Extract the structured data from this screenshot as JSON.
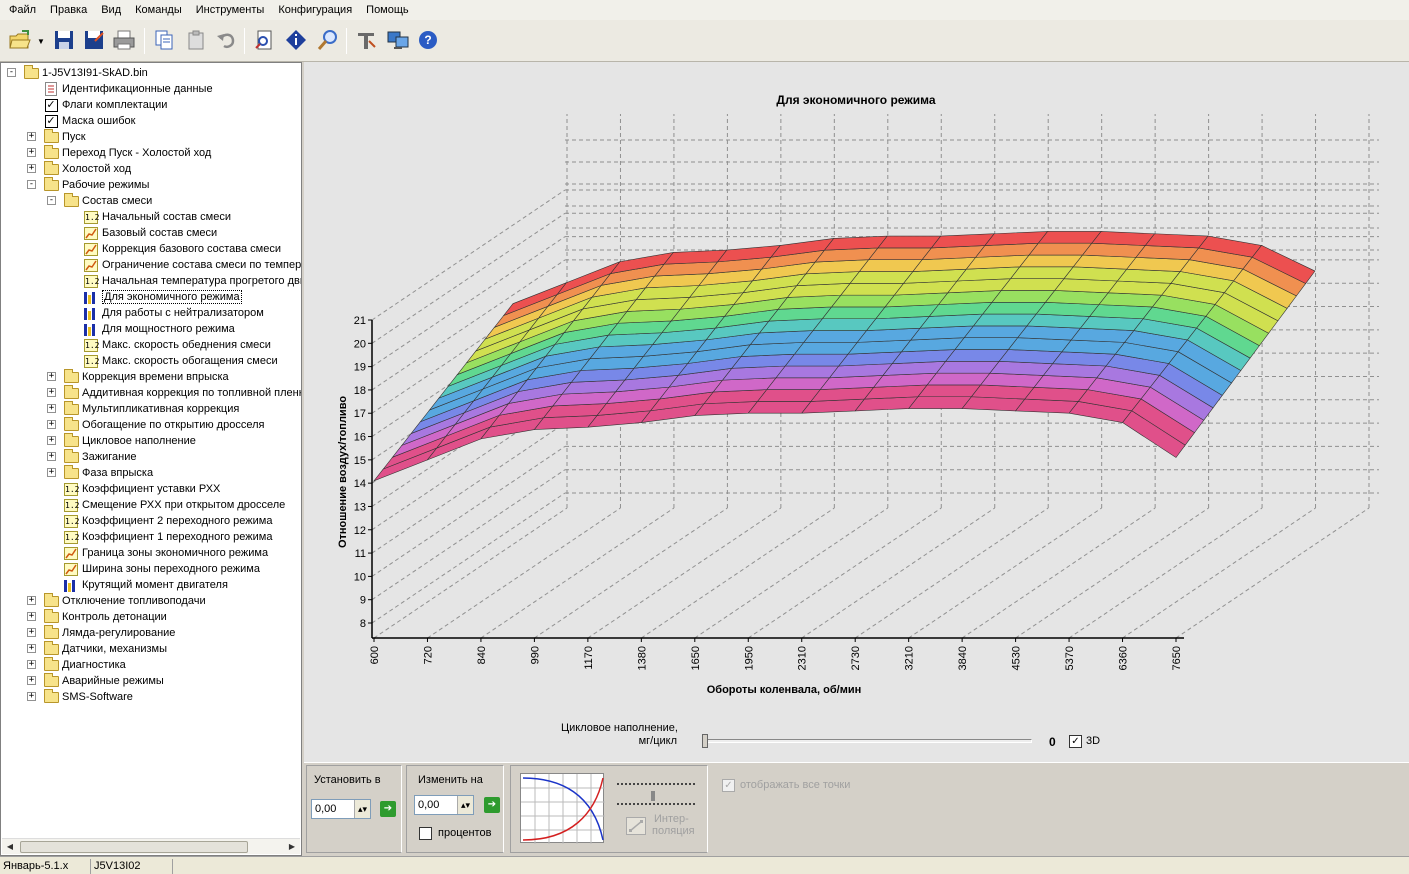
{
  "menu": [
    "Файл",
    "Правка",
    "Вид",
    "Команды",
    "Инструменты",
    "Конфигурация",
    "Помощь"
  ],
  "toolbar": {
    "buttons": [
      {
        "name": "open-icon",
        "x": 8,
        "color": "#3f8f3f"
      },
      {
        "name": "save-icon",
        "x": 50,
        "color": "#1c3f8c"
      },
      {
        "name": "save-as-icon",
        "x": 80,
        "color": "#1c3f8c"
      },
      {
        "name": "print-icon",
        "x": 110,
        "color": "#707070"
      },
      {
        "name": "copy-icon",
        "x": 150,
        "color": "#3b64b8"
      },
      {
        "name": "paste-icon",
        "x": 182,
        "color": "#8a8a8a"
      },
      {
        "name": "undo-icon",
        "x": 212,
        "color": "#8a8a8a"
      },
      {
        "name": "document-search-icon",
        "x": 250,
        "color": "#2a4fb0"
      },
      {
        "name": "info-icon",
        "x": 282,
        "color": "#1f3f9c"
      },
      {
        "name": "zoom-icon",
        "x": 314,
        "color": "#3b6dc8"
      },
      {
        "name": "tools-icon",
        "x": 352,
        "color": "#6a6a6a"
      },
      {
        "name": "network-icon",
        "x": 384,
        "color": "#3a78c8"
      },
      {
        "name": "help-icon",
        "x": 414,
        "color": "#2b5cc4"
      }
    ]
  },
  "tree": {
    "root": "1-J5V13I91-SkAD.bin",
    "items": [
      {
        "label": "1-J5V13I91-SkAD.bin",
        "level": 0,
        "icon": "folder",
        "exp": "-"
      },
      {
        "label": "Идентификационные данные",
        "level": 1,
        "icon": "doc"
      },
      {
        "label": "Флаги комплектации",
        "level": 1,
        "icon": "check"
      },
      {
        "label": "Маска ошибок",
        "level": 1,
        "icon": "check"
      },
      {
        "label": "Пуск",
        "level": 1,
        "icon": "folder",
        "exp": "+"
      },
      {
        "label": "Переход Пуск - Холостой ход",
        "level": 1,
        "icon": "folder",
        "exp": "+"
      },
      {
        "label": "Холостой ход",
        "level": 1,
        "icon": "folder",
        "exp": "+"
      },
      {
        "label": "Рабочие режимы",
        "level": 1,
        "icon": "folder",
        "exp": "-"
      },
      {
        "label": "Состав смеси",
        "level": 2,
        "icon": "folder",
        "exp": "-"
      },
      {
        "label": "Начальный состав смеси",
        "level": 3,
        "icon": "param"
      },
      {
        "label": "Базовый состав смеси",
        "level": 3,
        "icon": "curve"
      },
      {
        "label": "Коррекция базового состава смеси",
        "level": 3,
        "icon": "curve"
      },
      {
        "label": "Ограничение состава смеси по температуре",
        "level": 3,
        "icon": "curve"
      },
      {
        "label": "Начальная температура прогретого двигателя",
        "level": 3,
        "icon": "param"
      },
      {
        "label": "Для экономичного режима",
        "level": 3,
        "icon": "bar",
        "selected": true
      },
      {
        "label": "Для работы с нейтрализатором",
        "level": 3,
        "icon": "bar"
      },
      {
        "label": "Для мощностного режима",
        "level": 3,
        "icon": "bar"
      },
      {
        "label": "Макс. скорость обеднения смеси",
        "level": 3,
        "icon": "param"
      },
      {
        "label": "Макс. скорость обогащения смеси",
        "level": 3,
        "icon": "param"
      },
      {
        "label": "Коррекция времени впрыска",
        "level": 2,
        "icon": "folder",
        "exp": "+"
      },
      {
        "label": "Аддитивная коррекция по топливной пленке",
        "level": 2,
        "icon": "folder",
        "exp": "+"
      },
      {
        "label": "Мультипликативная коррекция",
        "level": 2,
        "icon": "folder",
        "exp": "+"
      },
      {
        "label": "Обогащение по открытию дросселя",
        "level": 2,
        "icon": "folder",
        "exp": "+"
      },
      {
        "label": "Цикловое наполнение",
        "level": 2,
        "icon": "folder",
        "exp": "+"
      },
      {
        "label": "Зажигание",
        "level": 2,
        "icon": "folder",
        "exp": "+"
      },
      {
        "label": "Фаза впрыска",
        "level": 2,
        "icon": "folder",
        "exp": "+"
      },
      {
        "label": "Коэффициент уставки РХХ",
        "level": 2,
        "icon": "param"
      },
      {
        "label": "Смещение РХХ при открытом дросселе",
        "level": 2,
        "icon": "param"
      },
      {
        "label": "Коэффициент 2 переходного режима",
        "level": 2,
        "icon": "param"
      },
      {
        "label": "Коэффициент 1 переходного режима",
        "level": 2,
        "icon": "param"
      },
      {
        "label": "Граница зоны экономичного режима",
        "level": 2,
        "icon": "curve"
      },
      {
        "label": "Ширина зоны переходного режима",
        "level": 2,
        "icon": "curve"
      },
      {
        "label": "Крутящий момент двигателя",
        "level": 2,
        "icon": "bar"
      },
      {
        "label": "Отключение топливоподачи",
        "level": 1,
        "icon": "folder",
        "exp": "+"
      },
      {
        "label": "Контроль детонации",
        "level": 1,
        "icon": "folder",
        "exp": "+"
      },
      {
        "label": "Лямда-регулирование",
        "level": 1,
        "icon": "folder",
        "exp": "+"
      },
      {
        "label": "Датчики, механизмы",
        "level": 1,
        "icon": "folder",
        "exp": "+"
      },
      {
        "label": "Диагностика",
        "level": 1,
        "icon": "folder",
        "exp": "+"
      },
      {
        "label": "Аварийные режимы",
        "level": 1,
        "icon": "folder",
        "exp": "+"
      },
      {
        "label": "SMS-Software",
        "level": 1,
        "icon": "folder",
        "exp": "+"
      }
    ]
  },
  "chart_data": {
    "type": "surface-3d",
    "title": "Для экономичного режима",
    "xlabel": "Обороты коленвала, об/мин",
    "ylabel": "Отношение воздух/топливо",
    "x_ticks": [
      "600",
      "720",
      "840",
      "990",
      "1170",
      "1380",
      "1650",
      "1950",
      "2310",
      "2730",
      "3210",
      "3840",
      "4530",
      "5370",
      "6360",
      "7650"
    ],
    "y_ticks": [
      "8",
      "9",
      "10",
      "11",
      "12",
      "13",
      "14",
      "15",
      "16",
      "17",
      "18",
      "19",
      "20",
      "21"
    ],
    "ylim": [
      8,
      21
    ],
    "grid": true
  },
  "cycle_fill": {
    "label_line1": "Цикловое наполнение,",
    "label_line2": "мг/цикл",
    "value": "0",
    "slider_fraction": 0,
    "check_3d_label": "3D",
    "check_3d": "✓"
  },
  "controls": {
    "set_label": "Установить в",
    "set_value": "0,00",
    "change_label": "Изменить на",
    "change_value": "0,00",
    "percent_label": "процентов",
    "interp_line1": "Интер-",
    "interp_line2": "поляция",
    "show_all_points": "отображать все точки",
    "show_all_check": "✓"
  },
  "status": {
    "panel1": "Январь-5.1.x",
    "panel2": "J5V13I02"
  }
}
